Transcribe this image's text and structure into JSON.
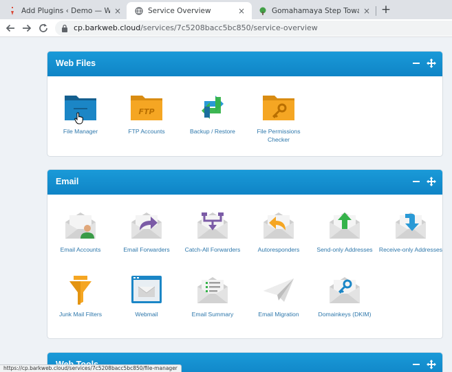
{
  "browser": {
    "tabs": [
      {
        "title": "Add Plugins ‹ Demo — WordPre",
        "active": false
      },
      {
        "title": "Service Overview",
        "active": true
      },
      {
        "title": "Gomahamaya Step Toward Pro B",
        "active": false
      }
    ],
    "close_glyph": "×",
    "new_tab_glyph": "+",
    "url_host": "cp.barkweb.cloud",
    "url_path": "/services/7c5208bacc5bc850/service-overview"
  },
  "panels": {
    "web_files": {
      "title": "Web Files",
      "items": [
        {
          "label": "File Manager",
          "icon": "folder-blue-icon"
        },
        {
          "label": "FTP Accounts",
          "icon": "ftp-folder-icon"
        },
        {
          "label": "Backup / Restore",
          "icon": "backup-restore-icon"
        },
        {
          "label": "File Permissions Checker",
          "icon": "key-folder-icon"
        }
      ]
    },
    "email": {
      "title": "Email",
      "items": [
        {
          "label": "Email Accounts",
          "icon": "email-accounts-icon"
        },
        {
          "label": "Email Forwarders",
          "icon": "email-forwarders-icon"
        },
        {
          "label": "Catch-All Forwarders",
          "icon": "catch-all-icon"
        },
        {
          "label": "Autoresponders",
          "icon": "autoresponders-icon"
        },
        {
          "label": "Send-only Addresses",
          "icon": "send-only-icon"
        },
        {
          "label": "Receive-only Addresses",
          "icon": "receive-only-icon"
        },
        {
          "label": "Junk Mail Filters",
          "icon": "funnel-icon"
        },
        {
          "label": "Webmail",
          "icon": "webmail-icon"
        },
        {
          "label": "Email Summary",
          "icon": "email-summary-icon"
        },
        {
          "label": "Email Migration",
          "icon": "paper-plane-icon"
        },
        {
          "label": "Domainkeys (DKIM)",
          "icon": "dkim-key-icon"
        }
      ]
    },
    "web_tools": {
      "title": "Web Tools"
    }
  },
  "status_url": "https://cp.barkweb.cloud/services/7c5208bacc5bc850/file-manager",
  "colors": {
    "panel_header": "#1a9ad8",
    "link": "#2d77ab",
    "folder_blue": "#1b86c6",
    "folder_orange": "#f5a623",
    "envelope": "#d9d9d9"
  }
}
